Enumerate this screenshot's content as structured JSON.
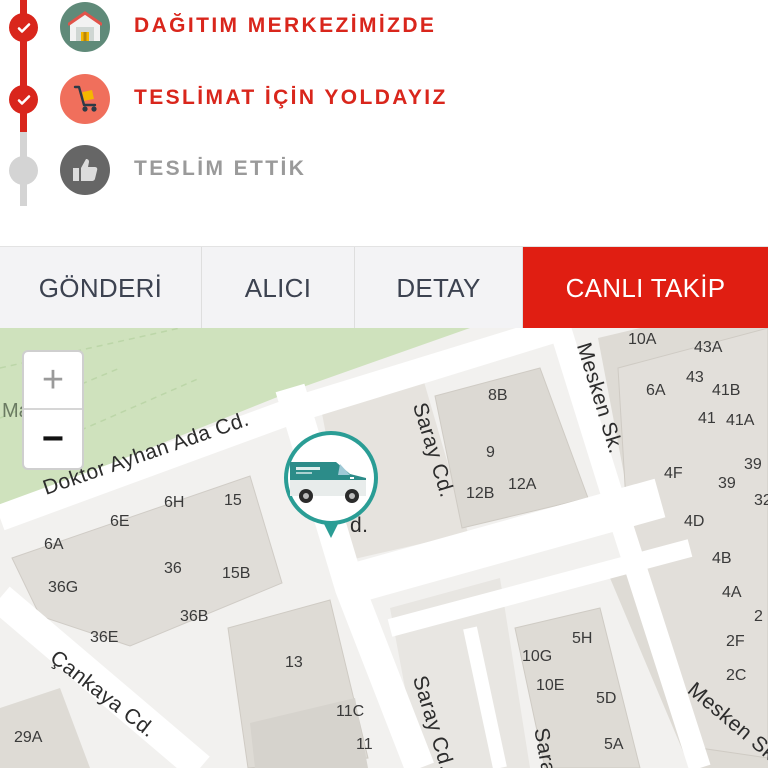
{
  "timeline": {
    "steps": [
      {
        "label": "DAĞITIM MERKEZİMİZDE",
        "status": "done",
        "icon": "warehouse-icon"
      },
      {
        "label": "TESLİMAT İÇİN YOLDAYIZ",
        "status": "done",
        "icon": "delivery-cart-icon"
      },
      {
        "label": "TESLİM ETTİK",
        "status": "pending",
        "icon": "thumbs-up-icon"
      }
    ]
  },
  "tabs": [
    {
      "label": "GÖNDERİ",
      "active": false
    },
    {
      "label": "ALICI",
      "active": false
    },
    {
      "label": "DETAY",
      "active": false
    },
    {
      "label": "CANLI TAKİP",
      "active": true
    }
  ],
  "map": {
    "zoom_in": "+",
    "zoom_out": "−",
    "park_label": "Ma   Parkı",
    "streets": {
      "doktor_ayhan": "Doktor Ayhan Ada Cd.",
      "saray_top": "Saray Cd.",
      "saray_bottom": "Saray Cd.",
      "saray_cut": "d.",
      "saray_right": "Sara",
      "mesken_top": "Mesken Sk.",
      "mesken_bottom": "Mesken Sk.",
      "cankaya": "Çankaya Cd."
    },
    "numbers": [
      "10A",
      "43A",
      "6A",
      "43",
      "41B",
      "41",
      "41A",
      "8B",
      "9",
      "12B",
      "12A",
      "4F",
      "39",
      "39",
      "4D",
      "4B",
      "4A",
      "2F",
      "2C",
      "6H",
      "15",
      "6E",
      "6A",
      "36G",
      "36",
      "15B",
      "36B",
      "36E",
      "13",
      "11C",
      "11",
      "29A",
      "10G",
      "5H",
      "10E",
      "5D",
      "5A",
      "32",
      "2"
    ]
  },
  "colors": {
    "accent": "#e01e12",
    "timeline_red": "#d9261c",
    "park": "#cfe2bd",
    "pin": "#2a9d95"
  }
}
